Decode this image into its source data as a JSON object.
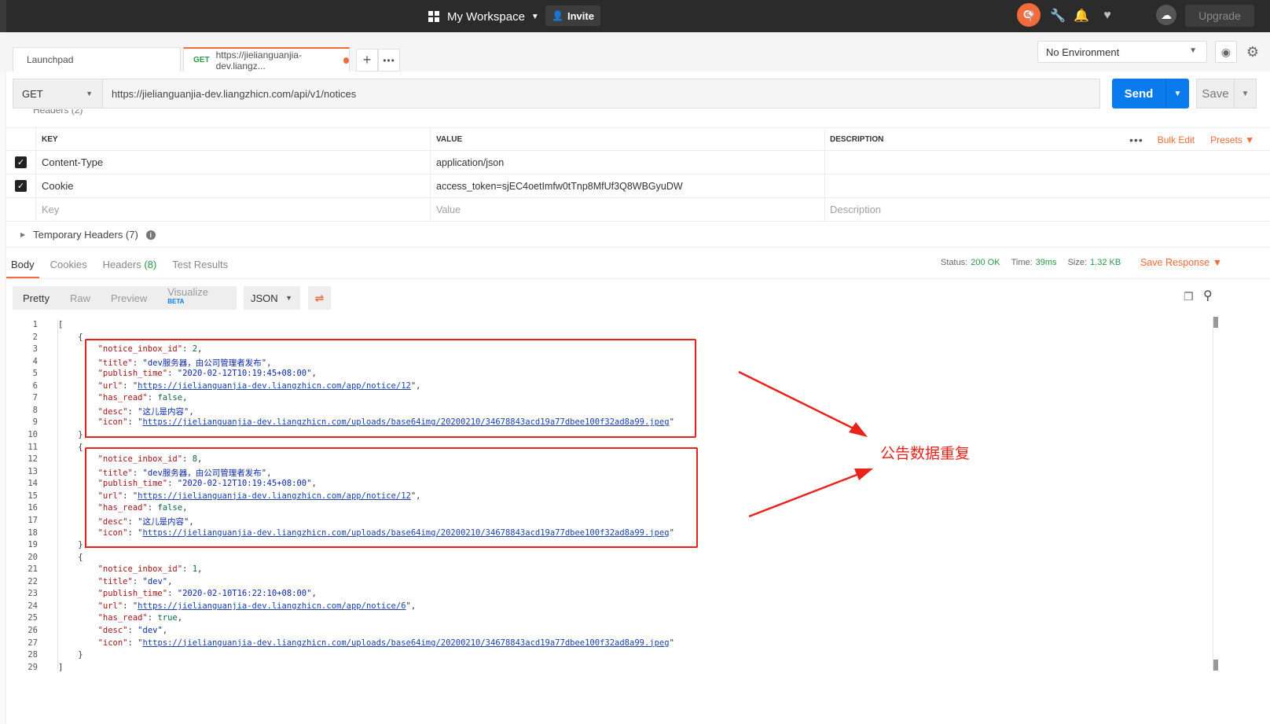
{
  "topbar": {
    "workspace_label": "My Workspace",
    "invite_label": "Invite",
    "upgrade_label": "Upgrade",
    "icons": [
      "apps-grid-icon",
      "sync-icon",
      "satellite-icon",
      "wrench-icon",
      "bell-icon",
      "heart-icon",
      "cloud-icon"
    ]
  },
  "tabs": {
    "launchpad_label": "Launchpad",
    "request_method": "GET",
    "request_title": "https://jielianguanjia-dev.liangz...",
    "environment": "No Environment"
  },
  "request": {
    "method": "GET",
    "url": "https://jielianguanjia-dev.liangzhicn.com/api/v1/notices",
    "send_label": "Send",
    "save_label": "Save"
  },
  "headers": {
    "section_label": "Headers (2)",
    "columns": {
      "key": "KEY",
      "value": "VALUE",
      "description": "DESCRIPTION"
    },
    "bulk_edit": "Bulk Edit",
    "presets": "Presets",
    "rows": [
      {
        "key": "Content-Type",
        "value": "application/json",
        "description": ""
      },
      {
        "key": "Cookie",
        "value": "access_token=sjEC4oetImfw0tTnp8MfUf3Q8WBGyuDW",
        "description": ""
      }
    ],
    "placeholders": {
      "key": "Key",
      "value": "Value",
      "description": "Description"
    },
    "temporary": "Temporary Headers (7)"
  },
  "response": {
    "tabs": {
      "body": "Body",
      "cookies": "Cookies",
      "headers_label": "Headers",
      "headers_count": "(8)",
      "tests": "Test Results"
    },
    "status_label": "Status:",
    "status_value": "200 OK",
    "time_label": "Time:",
    "time_value": "39ms",
    "size_label": "Size:",
    "size_value": "1.32 KB",
    "save_response": "Save Response",
    "formats": {
      "pretty": "Pretty",
      "raw": "Raw",
      "preview": "Preview",
      "visualize": "Visualize",
      "beta": "BETA"
    },
    "language": "JSON"
  },
  "code_lines": [
    "[",
    "    {",
    "        \"notice_inbox_id\": 2,",
    "        \"title\": \"dev服务器，由公司管理者发布\",",
    "        \"publish_time\": \"2020-02-12T10:19:45+08:00\",",
    "        \"url\": \"https://jielianguanjia-dev.liangzhicn.com/app/notice/12\",",
    "        \"has_read\": false,",
    "        \"desc\": \"这儿是内容\",",
    "        \"icon\": \"https://jielianguanjia-dev.liangzhicn.com/uploads/base64img/20200210/34678843acd19a77dbee100f32ad8a99.jpeg\"",
    "    },",
    "    {",
    "        \"notice_inbox_id\": 8,",
    "        \"title\": \"dev服务器，由公司管理者发布\",",
    "        \"publish_time\": \"2020-02-12T10:19:45+08:00\",",
    "        \"url\": \"https://jielianguanjia-dev.liangzhicn.com/app/notice/12\",",
    "        \"has_read\": false,",
    "        \"desc\": \"这儿是内容\",",
    "        \"icon\": \"https://jielianguanjia-dev.liangzhicn.com/uploads/base64img/20200210/34678843acd19a77dbee100f32ad8a99.jpeg\"",
    "    },",
    "    {",
    "        \"notice_inbox_id\": 1,",
    "        \"title\": \"dev\",",
    "        \"publish_time\": \"2020-02-10T16:22:10+08:00\",",
    "        \"url\": \"https://jielianguanjia-dev.liangzhicn.com/app/notice/6\",",
    "        \"has_read\": true,",
    "        \"desc\": \"dev\",",
    "        \"icon\": \"https://jielianguanjia-dev.liangzhicn.com/uploads/base64img/20200210/34678843acd19a77dbee100f32ad8a99.jpeg\"",
    "    }",
    "]"
  ],
  "annotation": {
    "text": "公告数据重复",
    "color": "#e8231c"
  },
  "colors": {
    "accent": "#f26b3a",
    "send": "#097bed",
    "success": "#2a9a45"
  }
}
